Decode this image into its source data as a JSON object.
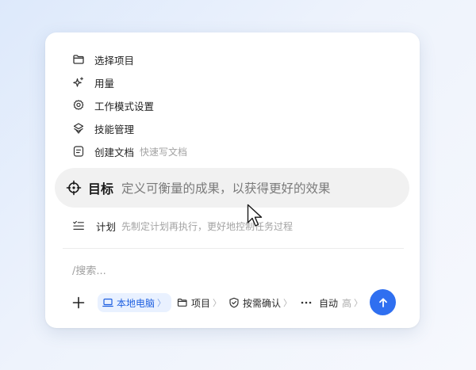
{
  "menu": {
    "items": [
      {
        "label": "选择项目",
        "icon": "folder-icon"
      },
      {
        "label": "用量",
        "icon": "sparkle-icon"
      },
      {
        "label": "工作模式设置",
        "icon": "gear-icon"
      },
      {
        "label": "技能管理",
        "icon": "layers-icon"
      },
      {
        "label": "创建文档",
        "hint": "快速写文档",
        "icon": "document-icon"
      }
    ],
    "goal": {
      "label": "目标",
      "description": "定义可衡量的成果，以获得更好的效果",
      "icon": "crosshair-icon"
    },
    "plan": {
      "label": "计划",
      "description": "先制定计划再执行，更好地控制任务过程",
      "icon": "checklist-icon"
    }
  },
  "input": {
    "placeholder": "/搜索..."
  },
  "toolbar": {
    "local_label": "本地电脑",
    "project_label": "项目",
    "confirm_label": "按需确认",
    "mode_label": "自动",
    "mode_level": "高",
    "chevron": "〉"
  },
  "colors": {
    "accent": "#2f6ff0",
    "chip_bg": "#e9f1ff",
    "highlight_row": "#f1f1f1"
  }
}
